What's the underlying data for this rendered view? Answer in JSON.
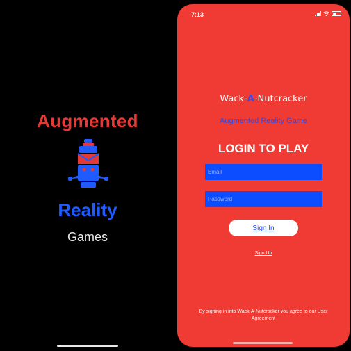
{
  "splash": {
    "line1": "Augmented",
    "line2": "Reality",
    "line3": "Games"
  },
  "status_bar": {
    "time": "7:13"
  },
  "login": {
    "app_title_before": "Wack-",
    "app_title_letter": "A",
    "app_title_after": "-Nutcracker",
    "subtitle": "Augmented Reality Game",
    "heading": "LOGIN TO PLAY",
    "email_placeholder": "Email",
    "password_placeholder": "Password",
    "signin_label": "Sign In",
    "signup_label": "Sign Up",
    "agreement": "By signing in into Wack-A-Nutcracker you agree to our User Agreement"
  },
  "colors": {
    "splash_red": "#e53935",
    "splash_blue": "#1f5bff",
    "login_background": "#ef3b33",
    "field_blue": "#0b4dff"
  }
}
